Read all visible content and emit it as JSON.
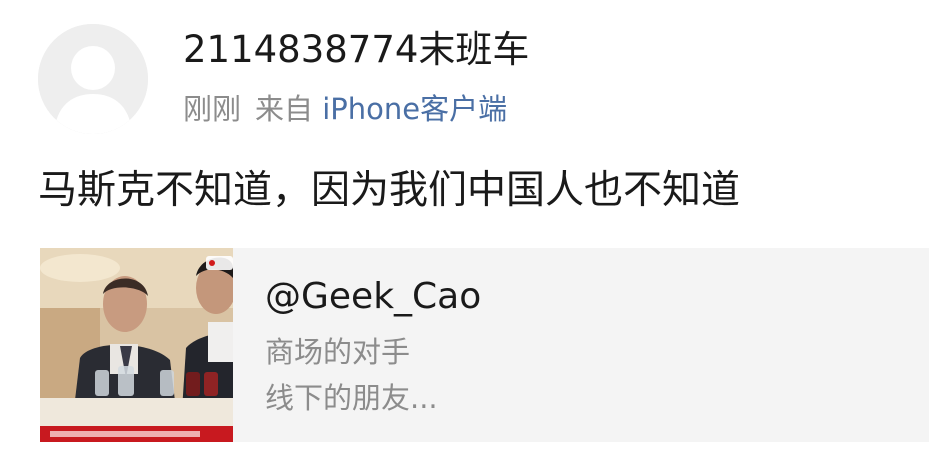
{
  "post": {
    "author": {
      "username": "2114838774末班车",
      "avatar_icon": "default-avatar-icon"
    },
    "meta": {
      "time": "刚刚",
      "from_label": "来自",
      "source": "iPhone客户端"
    },
    "text": "马斯克不知道，因为我们中国人也不知道",
    "repost": {
      "author": "@Geek_Cao",
      "lines": [
        "商场的对手",
        "线下的朋友..."
      ],
      "thumbnail_icon": "video-thumbnail"
    }
  },
  "colors": {
    "text": "#1a1a1a",
    "secondary": "#8c8c8c",
    "source_link": "#4a6fa5",
    "card_bg": "#f4f4f4",
    "avatar_bg": "#eeeeee"
  }
}
